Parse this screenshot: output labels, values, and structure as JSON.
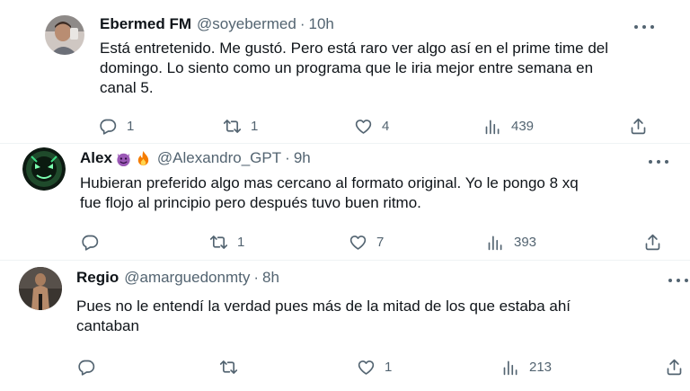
{
  "tweets": [
    {
      "name": "Ebermed FM",
      "handle": "@soyebermed",
      "separator": "·",
      "time": "10h",
      "text_lines": [
        "Está entretenido. Me gustó. Pero está raro ver algo así en el prime time del",
        "domingo. Lo siento como un programa que le iria mejor entre semana en",
        "canal 5."
      ],
      "replies": "1",
      "retweets": "1",
      "likes": "4",
      "views": "439",
      "name_emojis": []
    },
    {
      "name": "Alex",
      "handle": "@Alexandro_GPT",
      "separator": "·",
      "time": "9h",
      "text_lines": [
        "Hubieran preferido algo mas cercano al formato original. Yo le pongo 8 xq",
        "fue flojo al principio pero después tuvo buen ritmo."
      ],
      "replies": "",
      "retweets": "1",
      "likes": "7",
      "views": "393",
      "name_emojis": [
        "smiling-devil-emoji",
        "fire-emoji"
      ]
    },
    {
      "name": "Regio",
      "handle": "@amarguedonmty",
      "separator": "·",
      "time": "8h",
      "text_lines": [
        "Pues no le entendí la verdad pues más de la mitad de los que estaba ahí",
        "cantaban"
      ],
      "replies": "",
      "retweets": "",
      "likes": "1",
      "views": "213",
      "name_emojis": []
    }
  ],
  "icons": {
    "reply": "reply-icon",
    "retweet": "retweet-icon",
    "like": "heart-icon",
    "views": "views-icon",
    "share": "share-icon",
    "more": "more-icon"
  },
  "colors": {
    "text": "#0f1419",
    "secondary": "#536471",
    "divider": "#eff3f4"
  }
}
